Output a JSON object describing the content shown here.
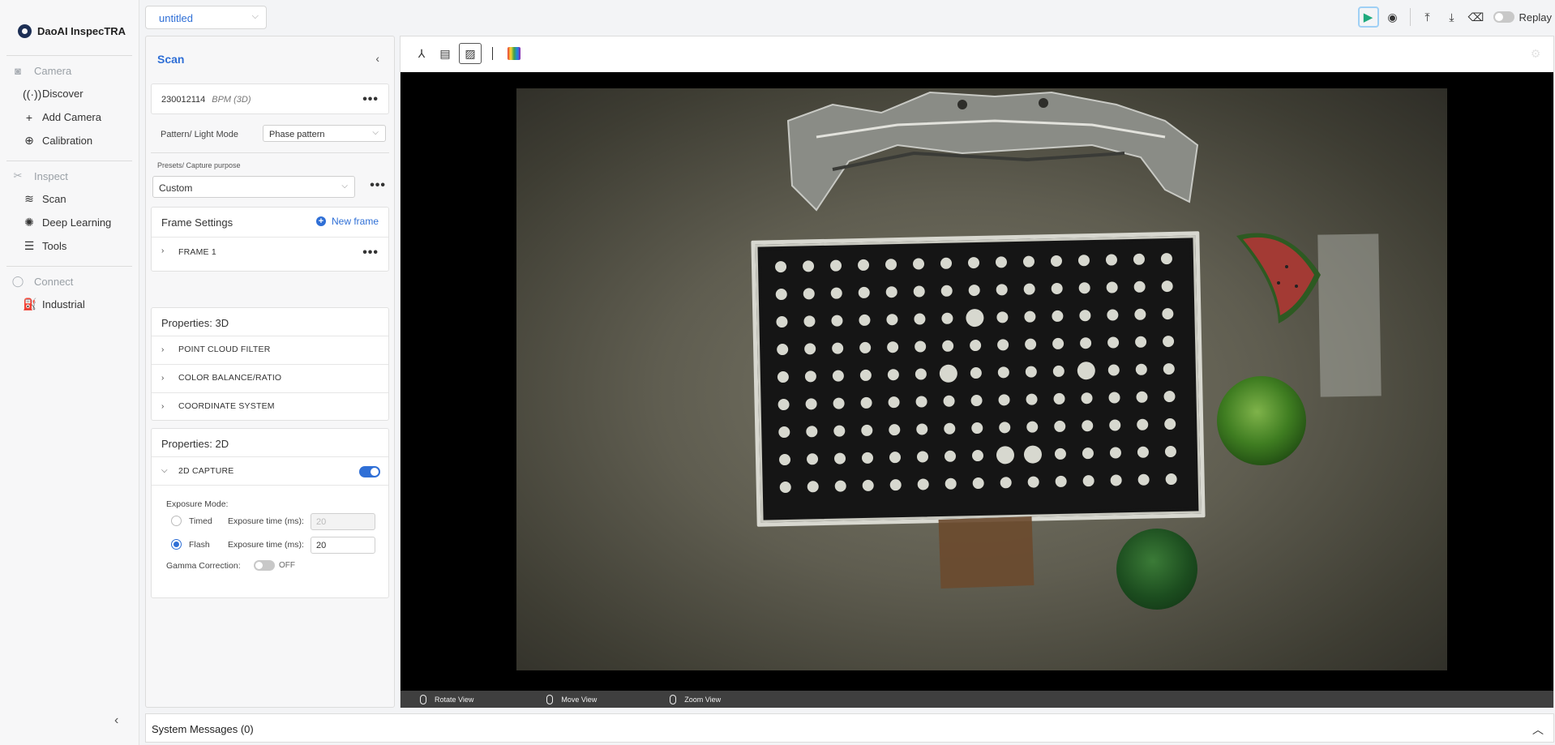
{
  "app": {
    "name": "DaoAI InspecTRA"
  },
  "sidebar": {
    "sections": [
      {
        "title": "Camera",
        "icon": "camera-icon",
        "items": [
          {
            "label": "Discover",
            "icon": "discover-icon"
          },
          {
            "label": "Add Camera",
            "icon": "plus-icon"
          },
          {
            "label": "Calibration",
            "icon": "calibration-icon"
          }
        ]
      },
      {
        "title": "Inspect",
        "icon": "inspect-icon",
        "items": [
          {
            "label": "Scan",
            "icon": "scan-icon"
          },
          {
            "label": "Deep Learning",
            "icon": "deep-learning-icon"
          },
          {
            "label": "Tools",
            "icon": "tools-icon"
          }
        ]
      },
      {
        "title": "Connect",
        "icon": "connect-icon",
        "items": [
          {
            "label": "Industrial",
            "icon": "industrial-icon"
          }
        ]
      }
    ]
  },
  "topbar": {
    "project": "untitled",
    "replay_label": "Replay"
  },
  "scan_panel": {
    "title": "Scan",
    "device": {
      "serial": "230012114",
      "model": "BPM (3D)"
    },
    "pattern_label": "Pattern/ Light Mode",
    "pattern_value": "Phase pattern",
    "presets_label": "Presets/ Capture purpose",
    "presets_value": "Custom",
    "frame_settings": {
      "title": "Frame Settings",
      "new_frame_label": "New frame",
      "frames": [
        "FRAME 1"
      ]
    },
    "props_3d": {
      "title": "Properties: 3D",
      "rows": [
        "POINT CLOUD FILTER",
        "COLOR BALANCE/RATIO",
        "COORDINATE SYSTEM"
      ]
    },
    "props_2d": {
      "title": "Properties: 2D",
      "capture_label": "2D CAPTURE",
      "exposure_mode_label": "Exposure Mode:",
      "timed_label": "Timed",
      "flash_label": "Flash",
      "exposure_time_label": "Exposure time (ms):",
      "timed_value": "20",
      "flash_value": "20",
      "gamma_label": "Gamma Correction:",
      "gamma_state": "OFF"
    }
  },
  "viewer": {
    "footer": [
      "Rotate View",
      "Move View",
      "Zoom View"
    ]
  },
  "system_messages": {
    "label": "System Messages (0)"
  }
}
